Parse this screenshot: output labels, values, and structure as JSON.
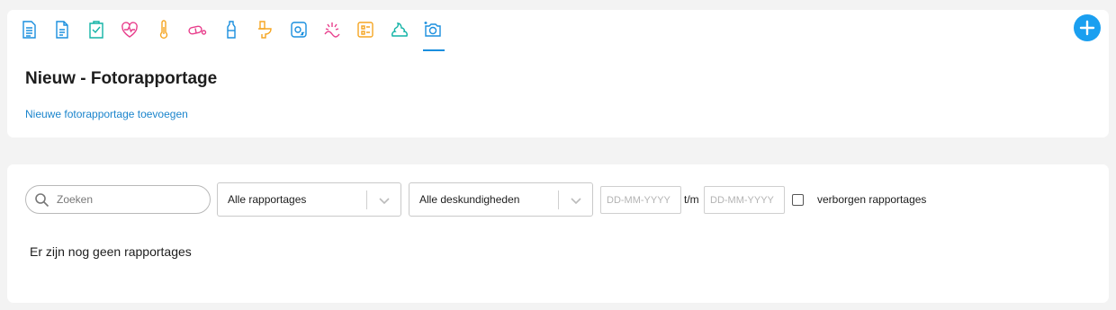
{
  "toolbar": {
    "icons": [
      {
        "name": "report-icon",
        "color": "#1a8fde"
      },
      {
        "name": "document-icon",
        "color": "#1a8fde"
      },
      {
        "name": "clipboard-check-icon",
        "color": "#12b3a6"
      },
      {
        "name": "heart-pulse-icon",
        "color": "#e83e8c"
      },
      {
        "name": "thermometer-icon",
        "color": "#f5a623"
      },
      {
        "name": "pill-icon",
        "color": "#e83e8c"
      },
      {
        "name": "bottle-icon",
        "color": "#1a8fde"
      },
      {
        "name": "toilet-icon",
        "color": "#f5a623"
      },
      {
        "name": "oxygen-icon",
        "color": "#1a8fde"
      },
      {
        "name": "pain-icon",
        "color": "#e83e8c"
      },
      {
        "name": "list-icon",
        "color": "#f5a623"
      },
      {
        "name": "stool-icon",
        "color": "#12b3a6"
      },
      {
        "name": "camera-icon",
        "color": "#1a8fde",
        "active": true
      }
    ],
    "add_button_color": "#1a9ff0"
  },
  "header": {
    "title": "Nieuw - Fotorapportage",
    "add_link": "Nieuwe fotorapportage toevoegen"
  },
  "filters": {
    "search_placeholder": "Zoeken",
    "report_select": "Alle rapportages",
    "expertise_select": "Alle deskundigheden",
    "date_from_placeholder": "DD-MM-YYYY",
    "date_separator": "t/m",
    "date_to_placeholder": "DD-MM-YYYY",
    "hidden_reports_label": "verborgen rapportages",
    "hidden_reports_checked": false
  },
  "results": {
    "empty_message": "Er zijn nog geen rapportages"
  }
}
